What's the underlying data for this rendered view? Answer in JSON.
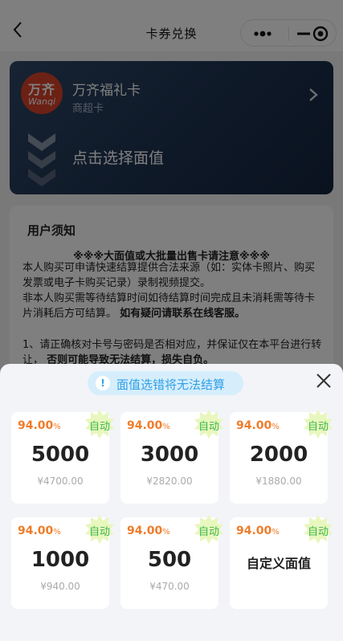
{
  "nav": {
    "title": "卡券兑换"
  },
  "card": {
    "logo_cn": "万齐",
    "logo_en": "Wanqi",
    "name": "万齐福礼卡",
    "subtitle": "商超卡",
    "select_label": "点击选择面值"
  },
  "notice": {
    "title": "用户须知",
    "warning": "※※※大面值或大批量出售卡请注意※※※",
    "para1": "本人购买可申请快速结算提供合法来源（如：实体卡照片、购买发票或电子卡购买记录）录制视频提交。",
    "para2": "非本人购买需等待结算时间如待结算时间完成且未消耗需等待卡片消耗后方可结算。",
    "para2_bold": "如有疑问请联系在线客服。",
    "rule1": "1、请正确核对卡号与密码是否相对应，并保证仅在本平台进行转让，",
    "rule1_bold": "否则可能导致无法结算，损失自负。"
  },
  "sheet": {
    "tip": "面值选错将无法结算",
    "badge_label": "自动",
    "discount_value": "94.00",
    "discount_unit": "%",
    "options": [
      {
        "face": "5000",
        "price": "¥4700.00"
      },
      {
        "face": "3000",
        "price": "¥2820.00"
      },
      {
        "face": "2000",
        "price": "¥1880.00"
      },
      {
        "face": "1000",
        "price": "¥940.00"
      },
      {
        "face": "500",
        "price": "¥470.00"
      }
    ],
    "custom_label": "自定义面值"
  },
  "colors": {
    "accent_orange": "#ef7c2a",
    "badge_green": "#3cb74a",
    "tip_blue": "#2f9fe8",
    "card_navy": "#1d3250",
    "logo_red": "#d9432a"
  }
}
